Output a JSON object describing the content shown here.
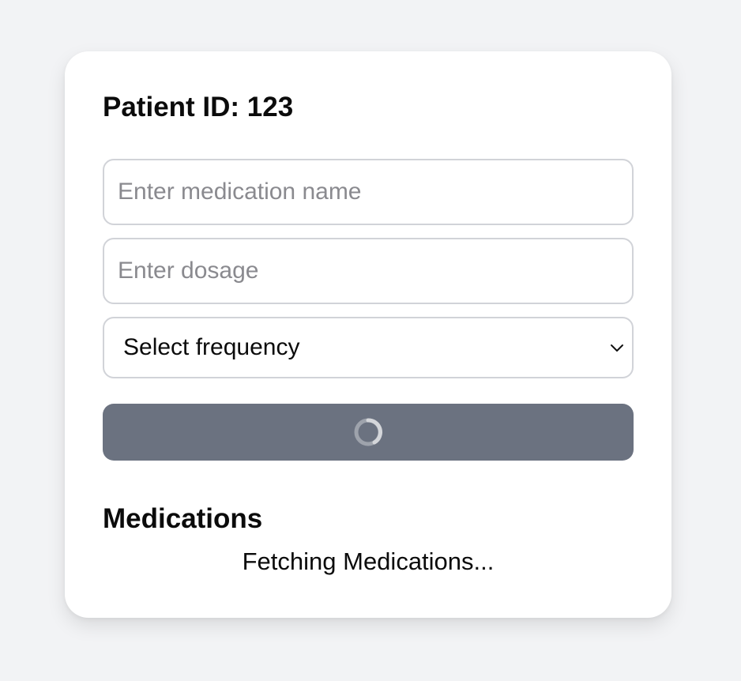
{
  "patient": {
    "title": "Patient ID: 123"
  },
  "form": {
    "medication_placeholder": "Enter medication name",
    "dosage_placeholder": "Enter dosage",
    "frequency_selected": "Select frequency",
    "submit_state": "loading"
  },
  "medications": {
    "heading": "Medications",
    "status": "Fetching Medications..."
  },
  "icons": {
    "select_chevron": "chevron-down-icon",
    "submit_spinner": "spinner-icon"
  },
  "colors": {
    "background": "#f2f3f5",
    "card": "#ffffff",
    "button": "#6b7280",
    "border": "#d1d3d8"
  }
}
